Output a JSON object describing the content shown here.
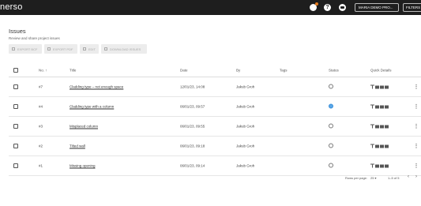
{
  "app": {
    "logo": "nerso"
  },
  "topbar": {
    "project_select": "MARIA DEMO PRO...",
    "filters": "FILTERS"
  },
  "page": {
    "title": "Issues",
    "subtitle": "Review and share project issues"
  },
  "toolbar": {
    "buttons": [
      "EXPORT BCF",
      "EXPORT PDF",
      "EDIT",
      "DOWNLOAD ISSUES"
    ]
  },
  "table": {
    "columns": [
      "No.",
      "Title",
      "Date",
      "By",
      "Tags",
      "Status",
      "Quick Details"
    ],
    "sort_indicator": "↑",
    "rows": [
      {
        "no": "#7",
        "title": "Cladding type – not enough space",
        "date": "12/01/23, 14:08",
        "by": "Jakub Groh",
        "tags": "",
        "status": "open"
      },
      {
        "no": "#4",
        "title": "Cladding type with a column",
        "date": "06/01/23, 09:57",
        "by": "Jakub Groh",
        "tags": "",
        "status": "in-progress"
      },
      {
        "no": "#3",
        "title": "Misplaced column",
        "date": "06/01/23, 09:55",
        "by": "Jakub Groh",
        "tags": "",
        "status": "closed"
      },
      {
        "no": "#2",
        "title": "Tilted wall",
        "date": "06/01/23, 09:18",
        "by": "Jakub Groh",
        "tags": "",
        "status": "closed"
      },
      {
        "no": "#1",
        "title": "Missing opening",
        "date": "06/01/23, 09:14",
        "by": "Jakub Groh",
        "tags": "",
        "status": "closed"
      }
    ]
  },
  "pagination": {
    "rows_per_page_label": "Rows per page:",
    "rows_per_page_value": "25 ▾",
    "range": "1–5 of 5",
    "prev": "‹",
    "next": "›"
  },
  "colors": {
    "topbar": "#1e1e1e",
    "status_blue": "#5aa7e8"
  }
}
